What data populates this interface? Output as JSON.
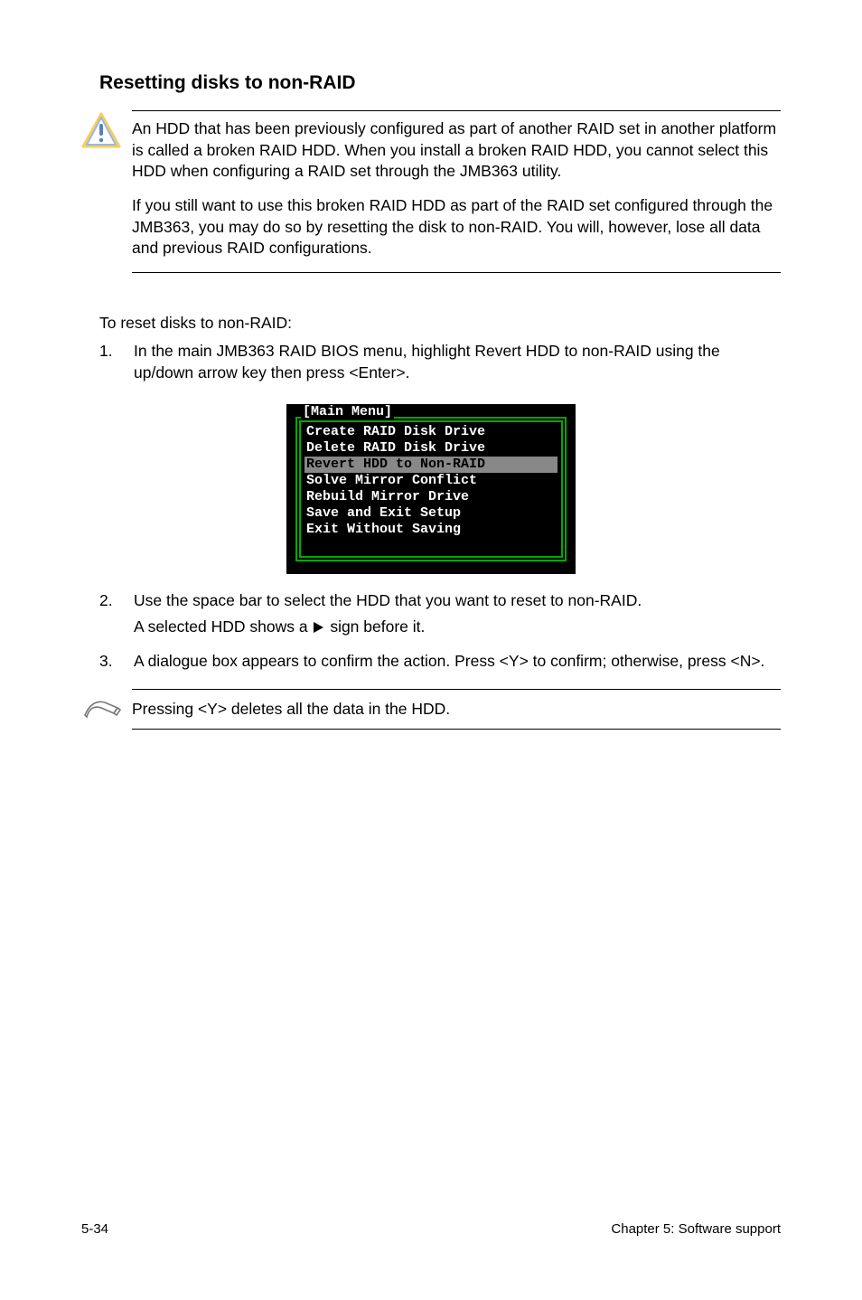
{
  "heading": "Resetting disks to non-RAID",
  "warning": {
    "p1": "An HDD that has been previously configured as part of another RAID set in another platform is called a broken RAID HDD. When you install a broken RAID HDD, you cannot select this HDD when configuring a RAID set through the JMB363 utility.",
    "p2": "If you still want to use this broken RAID HDD as part of the RAID set configured through the JMB363, you may do so by resetting the disk to non-RAID. You will, however, lose all data and previous RAID configurations."
  },
  "intro": "To reset disks to non-RAID:",
  "steps": {
    "s1": "In the main JMB363 RAID BIOS menu, highlight Revert HDD to non-RAID using the up/down arrow key then press <Enter>.",
    "s2a": "Use the space bar to select the HDD that you want to reset to non-RAID.",
    "s2b_pre": "A selected HDD shows a ",
    "s2b_post": " sign before it.",
    "s3": "A dialogue box appears to confirm the action. Press <Y> to confirm; otherwise, press <N>."
  },
  "bios": {
    "title": "[Main Menu]",
    "l1": "Create RAID Disk Drive",
    "l2": "Delete RAID Disk Drive",
    "l3": "Revert HDD to Non-RAID",
    "l4": "Solve Mirror Conflict",
    "l5": "Rebuild Mirror Drive",
    "l6": "Save and Exit Setup",
    "l7": "Exit Without Saving"
  },
  "note": "Pressing <Y> deletes all the data in the HDD.",
  "footer": {
    "left": "5-34",
    "right": "Chapter 5: Software support"
  }
}
